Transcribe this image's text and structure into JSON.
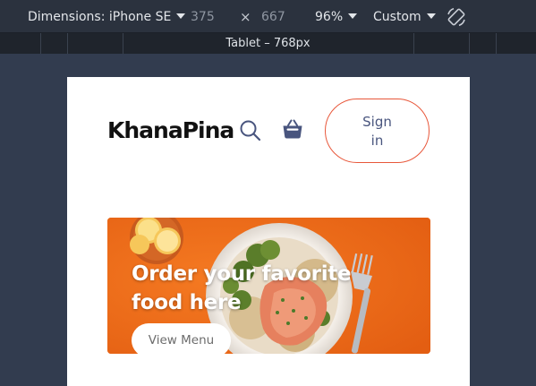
{
  "devtools": {
    "dimensions_label": "Dimensions: iPhone SE",
    "width": "375",
    "times": "×",
    "height": "667",
    "zoom": "96%",
    "throttle": "Custom",
    "media_query_label": "Tablet – 768px"
  },
  "site": {
    "logo": "KhanaPina",
    "signin_line1": "Sign",
    "signin_line2": "in",
    "hero": {
      "title": "Order your favorite food here",
      "button": "View Menu"
    }
  },
  "colors": {
    "accent": "#e8573a",
    "basket": "#49557e",
    "hero_orange": "#ec6b1c"
  },
  "icons": [
    "search-icon",
    "basket-icon",
    "rotate-icon",
    "chevron-down-icon"
  ]
}
